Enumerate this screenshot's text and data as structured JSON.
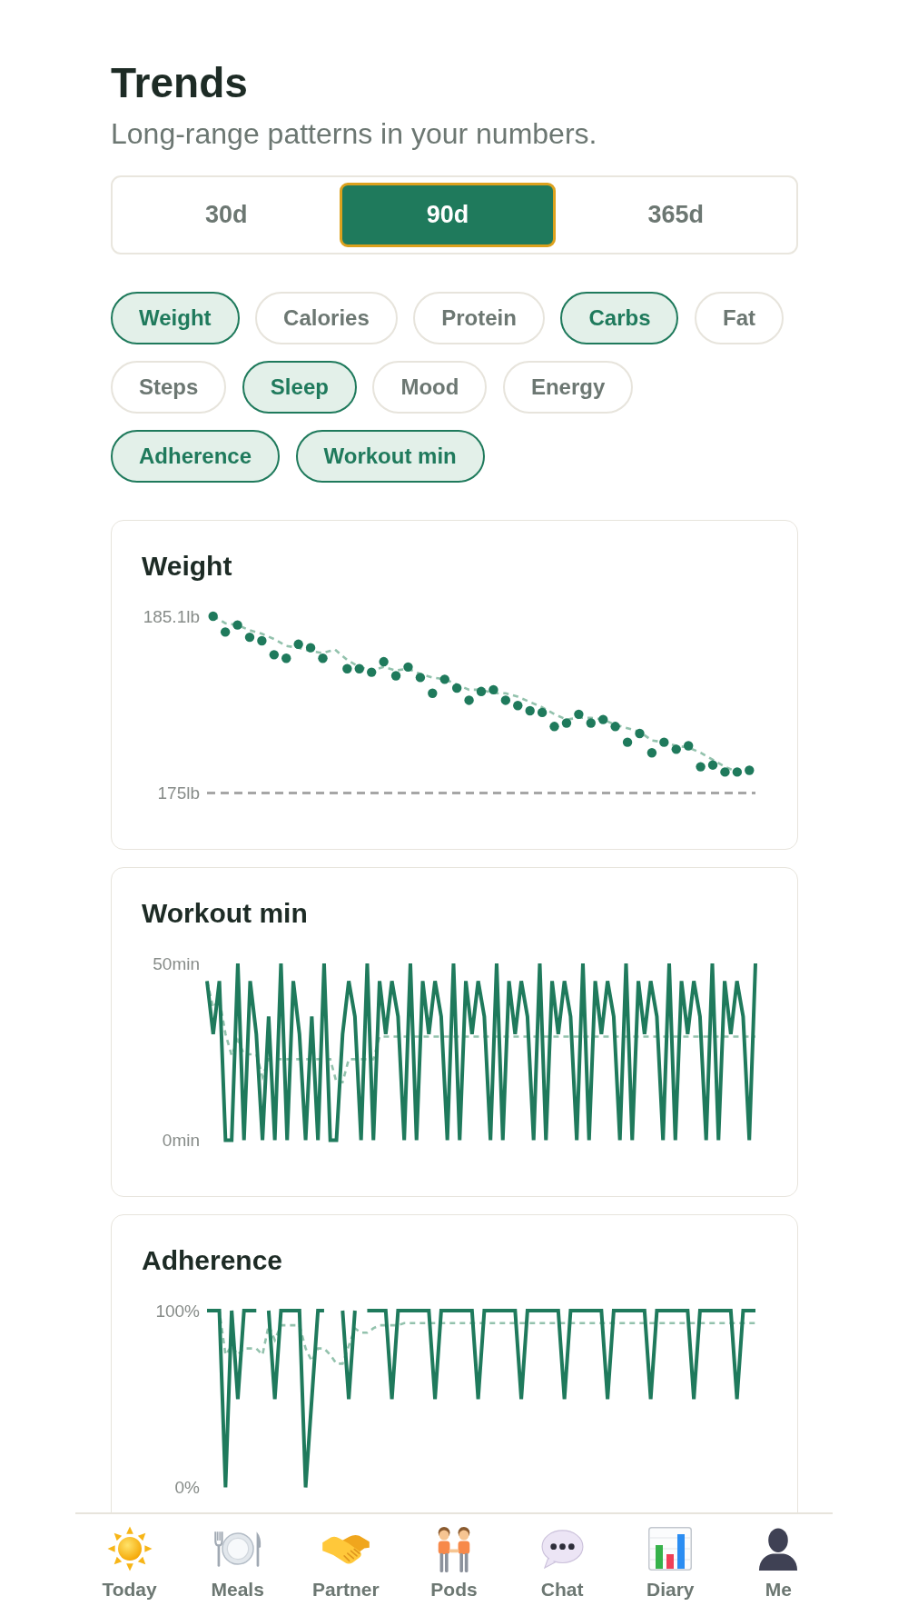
{
  "header": {
    "title": "Trends",
    "subtitle": "Long-range patterns in your numbers."
  },
  "periods": [
    {
      "label": "30d",
      "selected": false
    },
    {
      "label": "90d",
      "selected": true
    },
    {
      "label": "365d",
      "selected": false
    }
  ],
  "metrics": [
    {
      "label": "Weight",
      "selected": true
    },
    {
      "label": "Calories",
      "selected": false
    },
    {
      "label": "Protein",
      "selected": false
    },
    {
      "label": "Carbs",
      "selected": true
    },
    {
      "label": "Fat",
      "selected": false
    },
    {
      "label": "Steps",
      "selected": false
    },
    {
      "label": "Sleep",
      "selected": true
    },
    {
      "label": "Mood",
      "selected": false
    },
    {
      "label": "Energy",
      "selected": false
    },
    {
      "label": "Adherence",
      "selected": true
    },
    {
      "label": "Workout min",
      "selected": true
    }
  ],
  "cards": [
    {
      "chart_data": {
        "type": "scatter",
        "title": "Weight",
        "categories": [
          null,
          null,
          null,
          null,
          null,
          null,
          null,
          null,
          null,
          null,
          null,
          null,
          null,
          null,
          null,
          null,
          null,
          null,
          null,
          null,
          null,
          null,
          null,
          null,
          null,
          null,
          null,
          null,
          null,
          null,
          null,
          null,
          null,
          null,
          null,
          null,
          null,
          null,
          null,
          null,
          null,
          null,
          null,
          null,
          null
        ],
        "ylim": [
          175,
          185.1
        ],
        "yticks": [
          {
            "value": 175,
            "label": "175lb"
          },
          {
            "value": 185.1,
            "label": "185.1lb"
          }
        ],
        "ref_lines": [
          {
            "axis": "y",
            "value": 175,
            "line_style": "dashed"
          }
        ],
        "series": [
          {
            "color": "#1f7a5c",
            "values": [
              185.1,
              184.2,
              184.6,
              183.9,
              183.7,
              182.9,
              182.7,
              183.5,
              183.3,
              182.7,
              null,
              182.1,
              182.1,
              181.9,
              182.5,
              181.7,
              182.2,
              181.6,
              180.7,
              181.5,
              181.0,
              180.3,
              180.8,
              180.9,
              180.3,
              180.0,
              179.7,
              179.6,
              178.8,
              179.0,
              179.5,
              179.0,
              179.2,
              178.8,
              177.9,
              178.4,
              177.3,
              177.9,
              177.5,
              177.7,
              176.5,
              176.6,
              176.2,
              176.2,
              176.3
            ]
          },
          {
            "type": "line",
            "color": "#93c2ad",
            "line_style": "dashed",
            "values": [
              185.1,
              184.7,
              184.6,
              184.3,
              184.1,
              183.8,
              183.4,
              183.3,
              183.1,
              183.0,
              183.2,
              182.6,
              182.2,
              182.0,
              182.2,
              182.0,
              182.1,
              181.8,
              181.6,
              181.5,
              181.2,
              180.9,
              180.9,
              180.7,
              180.7,
              180.5,
              180.2,
              179.9,
              179.5,
              179.2,
              179.3,
              179.3,
              179.2,
              178.9,
              178.7,
              178.5,
              178.0,
              177.9,
              177.7,
              177.6,
              177.3,
              176.9,
              176.5,
              176.2,
              176.2
            ]
          }
        ]
      }
    },
    {
      "chart_data": {
        "type": "line",
        "title": "Workout min",
        "ylim": [
          0,
          50
        ],
        "yticks": [
          {
            "value": 0,
            "label": "0min"
          },
          {
            "value": 50,
            "label": "50min"
          }
        ],
        "series": [
          {
            "color": "#1f7a5c",
            "values": [
              45,
              30,
              45,
              0,
              0,
              50,
              0,
              45,
              30,
              0,
              35,
              0,
              50,
              0,
              45,
              30,
              0,
              35,
              0,
              50,
              0,
              0,
              30,
              45,
              35,
              0,
              50,
              0,
              45,
              30,
              45,
              35,
              0,
              50,
              0,
              45,
              30,
              45,
              35,
              0,
              50,
              0,
              45,
              30,
              45,
              35,
              0,
              50,
              0,
              45,
              30,
              45,
              35,
              0,
              50,
              0,
              45,
              30,
              45,
              35,
              0,
              50,
              0,
              45,
              30,
              45,
              35,
              0,
              50,
              0,
              45,
              30,
              45,
              35,
              0,
              50,
              0,
              45,
              30,
              45,
              35,
              0,
              50,
              0,
              45,
              30,
              45,
              35,
              0,
              50
            ]
          },
          {
            "color": "#93c2ad",
            "line_style": "dashed",
            "values": [
              45,
              37.5,
              40,
              30,
              24,
              28.3,
              24.3,
              24.3,
              24.3,
              17.9,
              22.9,
              22.9,
              22.9,
              22.9,
              22.9,
              22.9,
              22.9,
              22.9,
              22.9,
              22.9,
              22.9,
              16.4,
              16.4,
              22.9,
              22.9,
              22.9,
              22.9,
              22.9,
              29.3,
              29.3,
              29.3,
              29.3,
              29.3,
              29.3,
              29.3,
              29.3,
              29.3,
              29.3,
              29.3,
              29.3,
              29.3,
              29.3,
              29.3,
              29.3,
              29.3,
              29.3,
              29.3,
              29.3,
              29.3,
              29.3,
              29.3,
              29.3,
              29.3,
              29.3,
              29.3,
              29.3,
              29.3,
              29.3,
              29.3,
              29.3,
              29.3,
              29.3,
              29.3,
              29.3,
              29.3,
              29.3,
              29.3,
              29.3,
              29.3,
              29.3,
              29.3,
              29.3,
              29.3,
              29.3,
              29.3,
              29.3,
              29.3,
              29.3,
              29.3,
              29.3,
              29.3,
              29.3,
              29.3,
              29.3,
              29.3,
              29.3,
              29.3,
              29.3,
              29.3,
              29.3
            ]
          }
        ]
      }
    },
    {
      "chart_data": {
        "type": "line",
        "title": "Adherence",
        "ylim": [
          0,
          100
        ],
        "yticks": [
          {
            "value": 0,
            "label": "0%"
          },
          {
            "value": 100,
            "label": "100%"
          }
        ],
        "series": [
          {
            "color": "#1f7a5c",
            "values": [
              100,
              100,
              100,
              0,
              100,
              50,
              100,
              100,
              100,
              null,
              100,
              50,
              100,
              100,
              100,
              100,
              0,
              50,
              100,
              100,
              null,
              null,
              100,
              50,
              100,
              null,
              100,
              100,
              100,
              100,
              50,
              100,
              100,
              100,
              100,
              100,
              100,
              50,
              100,
              100,
              100,
              100,
              100,
              100,
              50,
              100,
              100,
              100,
              100,
              100,
              100,
              50,
              100,
              100,
              100,
              100,
              100,
              100,
              50,
              100,
              100,
              100,
              100,
              100,
              100,
              50,
              100,
              100,
              100,
              100,
              100,
              100,
              50,
              100,
              100,
              100,
              100,
              100,
              100,
              50,
              100,
              100,
              100,
              100,
              100,
              100,
              50,
              100,
              100,
              100
            ]
          },
          {
            "color": "#93c2ad",
            "line_style": "dashed",
            "values": [
              100,
              100,
              100,
              75,
              80,
              75,
              78.6,
              78.6,
              78.6,
              75,
              91.7,
              83.3,
              91.7,
              91.7,
              91.7,
              91.7,
              78.6,
              71.4,
              78.6,
              78.6,
              75,
              70,
              70,
              80,
              90,
              87.5,
              87.5,
              90,
              91.7,
              91.7,
              91.7,
              91.7,
              92.9,
              92.9,
              92.9,
              92.9,
              92.9,
              92.9,
              92.9,
              92.9,
              92.9,
              92.9,
              92.9,
              92.9,
              92.9,
              92.9,
              92.9,
              92.9,
              92.9,
              92.9,
              92.9,
              92.9,
              92.9,
              92.9,
              92.9,
              92.9,
              92.9,
              92.9,
              92.9,
              92.9,
              92.9,
              92.9,
              92.9,
              92.9,
              92.9,
              92.9,
              92.9,
              92.9,
              92.9,
              92.9,
              92.9,
              92.9,
              92.9,
              92.9,
              92.9,
              92.9,
              92.9,
              92.9,
              92.9,
              92.9,
              92.9,
              92.9,
              92.9,
              92.9,
              92.9,
              92.9,
              92.9,
              92.9,
              92.9,
              92.9
            ]
          }
        ]
      }
    }
  ],
  "nav": [
    {
      "label": "Today",
      "selected": false
    },
    {
      "label": "Meals",
      "selected": false
    },
    {
      "label": "Partner",
      "selected": false
    },
    {
      "label": "Pods",
      "selected": false
    },
    {
      "label": "Chat",
      "selected": false
    },
    {
      "label": "Diary",
      "selected": false
    },
    {
      "label": "Me",
      "selected": false
    }
  ]
}
